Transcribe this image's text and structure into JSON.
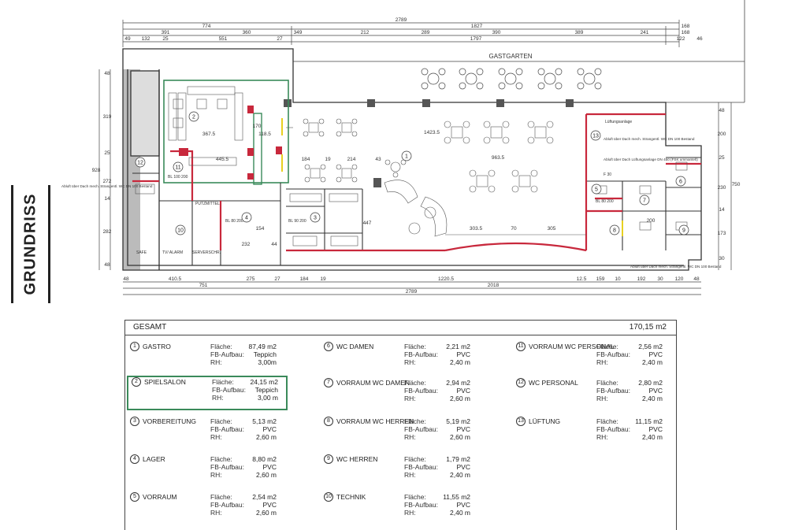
{
  "title": "GRUNDRISS",
  "plan": {
    "top_dims": {
      "overall": "2789",
      "row2": [
        "774",
        "1827",
        "168"
      ],
      "row3": [
        "391",
        "360",
        "349",
        "212",
        "289",
        "390",
        "389",
        "241",
        "168"
      ],
      "row4": [
        "49",
        "132",
        "25",
        "551",
        "27",
        "1797",
        "122",
        "46"
      ]
    },
    "bottom_dims": {
      "row1": [
        "48",
        "410.5",
        "275",
        "27",
        "184",
        "19",
        "1220.5",
        "12.5",
        "159",
        "10",
        "192",
        "30",
        "120",
        "48"
      ],
      "row2": [
        "751",
        "2018"
      ],
      "overall": "2789"
    },
    "left_dims": [
      "48",
      "319",
      "25",
      "272",
      "14",
      "282",
      "48",
      "928"
    ],
    "right_dims": [
      "48",
      "200",
      "25",
      "230",
      "14",
      "173",
      "30",
      "750"
    ],
    "interior_dims": [
      "367.5",
      "445.5",
      "118.5",
      "170",
      "184",
      "19",
      "214",
      "43",
      "1423.5",
      "963.5",
      "303.5",
      "70",
      "305",
      "447",
      "232",
      "44",
      "154",
      "200"
    ],
    "gastgarten": "GASTGARTEN",
    "room_numbers": [
      "1",
      "2",
      "3",
      "4",
      "5",
      "6",
      "7",
      "8",
      "9",
      "10",
      "11",
      "12",
      "13"
    ],
    "notes": {
      "left": "Abluft über Dach mech. Strangentl. WC DN 100 Bestand",
      "right_top": "Abluft über Dach mech. Strangentl. WC DN 100 Bestand",
      "right_mid": "Abluft über Dach Lüftungsanlage DN 450 (FSK ummantelt)",
      "right_bottom": "Abluft über Dach mech. Strangentl. WC DN 100 Bestand",
      "luftung": "Lüftungsanlage",
      "f30": "F 30"
    },
    "small_labels": {
      "bl1": "BL 80 200",
      "bl2": "BL 90 200",
      "bl3": "BL 100 200",
      "bl4": "BL 80 200",
      "safe": "SAFE",
      "tv_alarm": "TV/ ALARM",
      "server": "SERVERSCHR.",
      "putzmittel": "PUTZMITTEL"
    }
  },
  "table": {
    "total_label": "GESAMT",
    "total_value": "170,15 m2",
    "labels": [
      "Fläche:",
      "FB-Aufbau:",
      "RH:"
    ],
    "rooms": [
      {
        "num": "1",
        "name": "GASTRO",
        "area": "87,49 m2",
        "floor": "Teppich",
        "rh": "3,00m"
      },
      {
        "num": "2",
        "name": "SPIELSALON",
        "area": "24,15 m2",
        "floor": "Teppich",
        "rh": "3,00 m"
      },
      {
        "num": "3",
        "name": "VORBEREITUNG",
        "area": "5,13 m2",
        "floor": "PVC",
        "rh": "2,60 m"
      },
      {
        "num": "4",
        "name": "LAGER",
        "area": "8,80 m2",
        "floor": "PVC",
        "rh": "2,60 m"
      },
      {
        "num": "5",
        "name": "VORRAUM",
        "area": "2,54 m2",
        "floor": "PVC",
        "rh": "2,60 m"
      },
      {
        "num": "6",
        "name": "WC DAMEN",
        "area": "2,21 m2",
        "floor": "PVC",
        "rh": "2,40 m"
      },
      {
        "num": "7",
        "name": "VORRAUM WC DAMEN",
        "area": "2,94 m2",
        "floor": "PVC",
        "rh": "2,60 m"
      },
      {
        "num": "8",
        "name": "VORRAUM WC HERREN",
        "area": "5,19 m2",
        "floor": "PVC",
        "rh": "2,60 m"
      },
      {
        "num": "9",
        "name": "WC HERREN",
        "area": "1,79 m2",
        "floor": "PVC",
        "rh": "2,40 m"
      },
      {
        "num": "10",
        "name": "TECHNIK",
        "area": "11,55 m2",
        "floor": "PVC",
        "rh": "2,40 m"
      },
      {
        "num": "11",
        "name": "VORRAUM WC PERSONAL",
        "area": "2,56 m2",
        "floor": "PVC",
        "rh": "2,40 m"
      },
      {
        "num": "12",
        "name": "WC PERSONAL",
        "area": "2,80 m2",
        "floor": "PVC",
        "rh": "2,40 m"
      },
      {
        "num": "13",
        "name": "LÜFTUNG",
        "area": "11,15 m2",
        "floor": "PVC",
        "rh": "2,40 m"
      }
    ]
  },
  "colors": {
    "wall": "#333333",
    "fire_wall": "#c8283c",
    "highlight": "#3a8a5a",
    "yellow_door": "#e8d020"
  }
}
